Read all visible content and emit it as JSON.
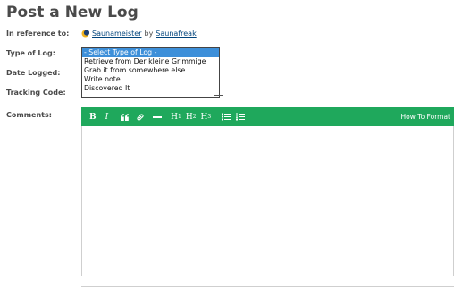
{
  "page": {
    "title": "Post a New Log"
  },
  "form": {
    "reference_label": "In reference to:",
    "reference_cache_name": "Saunameister",
    "reference_by": "by",
    "reference_owner": "Saunafreak",
    "type_label": "Type of Log:",
    "date_label": "Date Logged:",
    "tracking_label": "Tracking Code:",
    "comments_label": "Comments:"
  },
  "log_type_options": [
    "- Select Type of Log -",
    "Retrieve from Der kleine Grimmige",
    "Grab it from somewhere else",
    "Write note",
    "Discovered It"
  ],
  "selected_option_index": 0,
  "editor": {
    "toolbar": {
      "bold": "B",
      "italic": "I",
      "quote": "❝",
      "link": "🔗",
      "hr": "—",
      "h1": "H",
      "h1_num": "1",
      "h2": "H",
      "h2_num": "2",
      "h3": "H",
      "h3_num": "3",
      "bullet_list": "☰",
      "numbered_list": "☷"
    },
    "how_to_format": "How To Format",
    "toolbar_color": "#1fa85c"
  },
  "colors": {
    "link": "#00447c",
    "selected": "#3d8fd9"
  }
}
